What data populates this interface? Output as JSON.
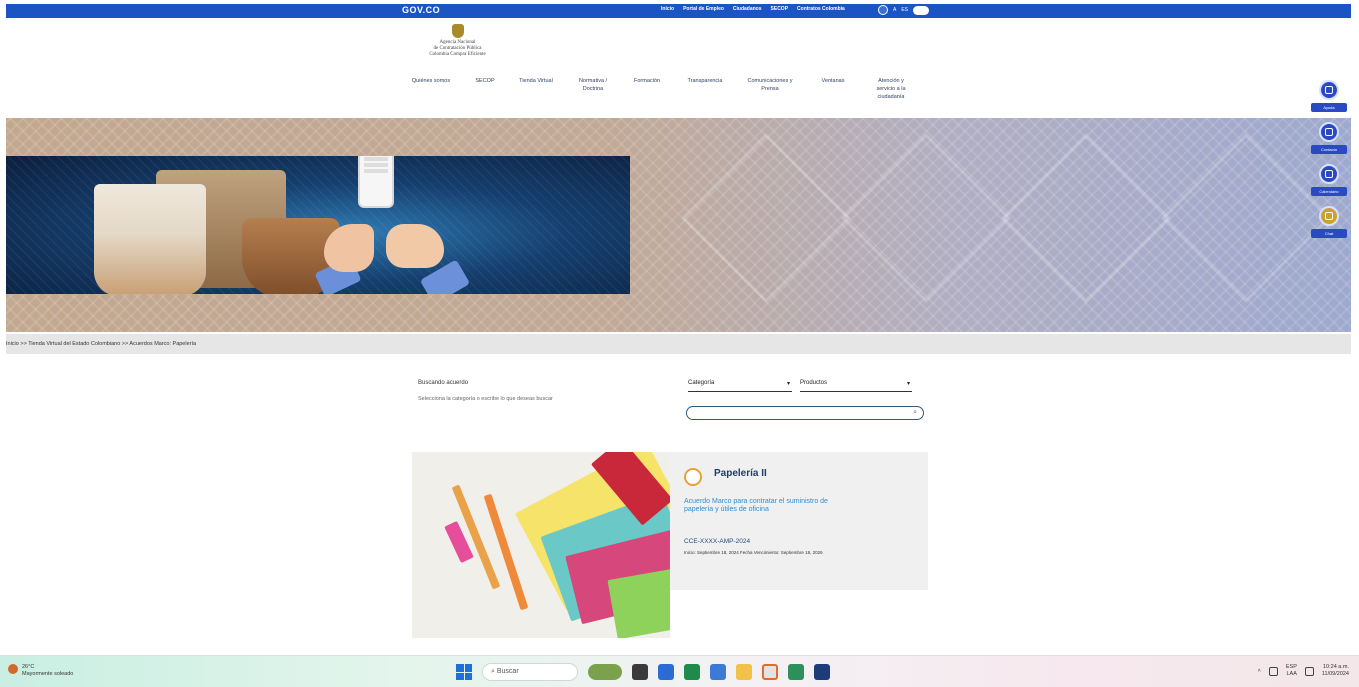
{
  "gov_bar": {
    "logo": "GOV.CO",
    "links": [
      "Inicio",
      "Portal de Empleo",
      "Ciudadanos",
      "SECOP",
      "Contratos Colombia"
    ],
    "contrast_label": "A",
    "lang_label": "ES",
    "color": "#1b55c4"
  },
  "logo": {
    "lines": [
      "Agencia Nacional",
      "de Contratación Pública",
      "Colombia Compra Eficiente"
    ]
  },
  "nav": {
    "items": [
      "Quiénes somos",
      "SECOP",
      "Tienda Virtual",
      "Normativa / Doctrina",
      "Formación",
      "Transparencia",
      "Comunicaciones y Prensa",
      "Ventanas",
      "Atención y servicio a la ciudadanía"
    ]
  },
  "rail": {
    "items": [
      {
        "label": "Ayuda",
        "icon": "help-icon"
      },
      {
        "label": "Contacto",
        "icon": "location-icon"
      },
      {
        "label": "Calendario",
        "icon": "calendar-icon"
      },
      {
        "label": "Chat",
        "icon": "chat-icon"
      }
    ]
  },
  "breadcrumb": {
    "text": "Inicio >> Tienda Virtual del Estado Colombiano >> Acuerdos Marco: Papelería"
  },
  "filter": {
    "title": "Buscando acuerdo",
    "description": "Selecciona la categoría o escribe lo que deseas buscar",
    "category_value": "Categoría",
    "product_value": "Productos",
    "search_placeholder": ""
  },
  "card": {
    "title": "Papelería II",
    "subtitle": "Acuerdo Marco para contratar el suministro de papelería y útiles de oficina",
    "code": "CCE-XXXX-AMP-2024",
    "dates": "Inicio: Septiembre 18, 2024   Fecha Vencimiento: Septiembre 18, 2026"
  },
  "taskbar": {
    "weather_temp": "26°C",
    "weather_desc": "Mayormente soleado",
    "search_label": "Buscar",
    "tray_lang": "ESP\nLAA",
    "tray_time": "10:24 a.m.",
    "tray_date": "11/09/2024"
  }
}
